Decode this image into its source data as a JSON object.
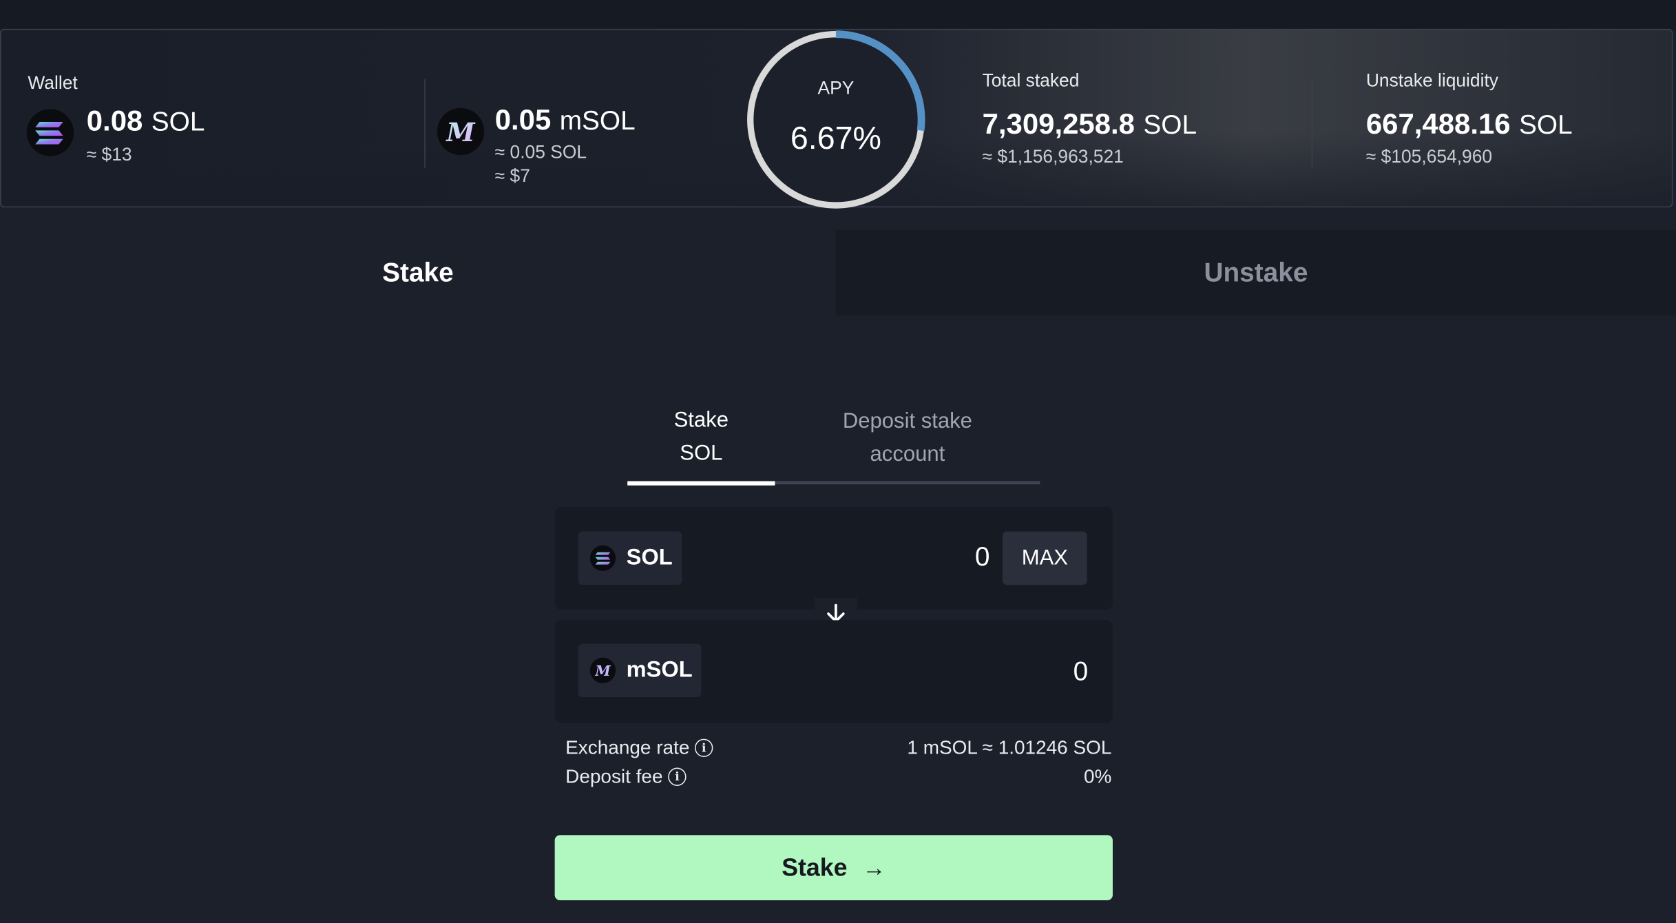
{
  "colors": {
    "background": "#1c202b",
    "accent_green": "#b1f7c0",
    "apy_ring": "#5591c4",
    "apy_ring_track": "#d9d9d9"
  },
  "stats": {
    "wallet": {
      "label": "Wallet",
      "sol_amount": "0.08",
      "sol_unit": "SOL",
      "sol_usd": "≈ $13",
      "msol_amount": "0.05",
      "msol_unit": "mSOL",
      "msol_in_sol": "≈ 0.05 SOL",
      "msol_usd": "≈ $7"
    },
    "apy": {
      "label": "APY",
      "value": "6.67%",
      "ring_fraction": 0.27
    },
    "total_staked": {
      "label": "Total staked",
      "amount": "7,309,258.8",
      "unit": "SOL",
      "usd": "≈ $1,156,963,521"
    },
    "unstake_liquidity": {
      "label": "Unstake liquidity",
      "amount": "667,488.16",
      "unit": "SOL",
      "usd": "≈ $105,654,960"
    }
  },
  "tabs": {
    "stake": "Stake",
    "unstake": "Unstake"
  },
  "subtabs": {
    "stake_sol_line1": "Stake",
    "stake_sol_line2": "SOL",
    "deposit_line1": "Deposit stake",
    "deposit_line2": "account"
  },
  "form": {
    "from_token": "SOL",
    "from_amount": "0",
    "max_label": "MAX",
    "to_token": "mSOL",
    "to_amount": "0",
    "exchange_rate_label": "Exchange rate",
    "exchange_rate_value": "1 mSOL ≈ 1.01246 SOL",
    "deposit_fee_label": "Deposit fee",
    "deposit_fee_value": "0%",
    "info_icon": "info-icon",
    "arrow_icon": "arrow-down-icon"
  },
  "stake_button": {
    "label": "Stake",
    "arrow": "→"
  }
}
